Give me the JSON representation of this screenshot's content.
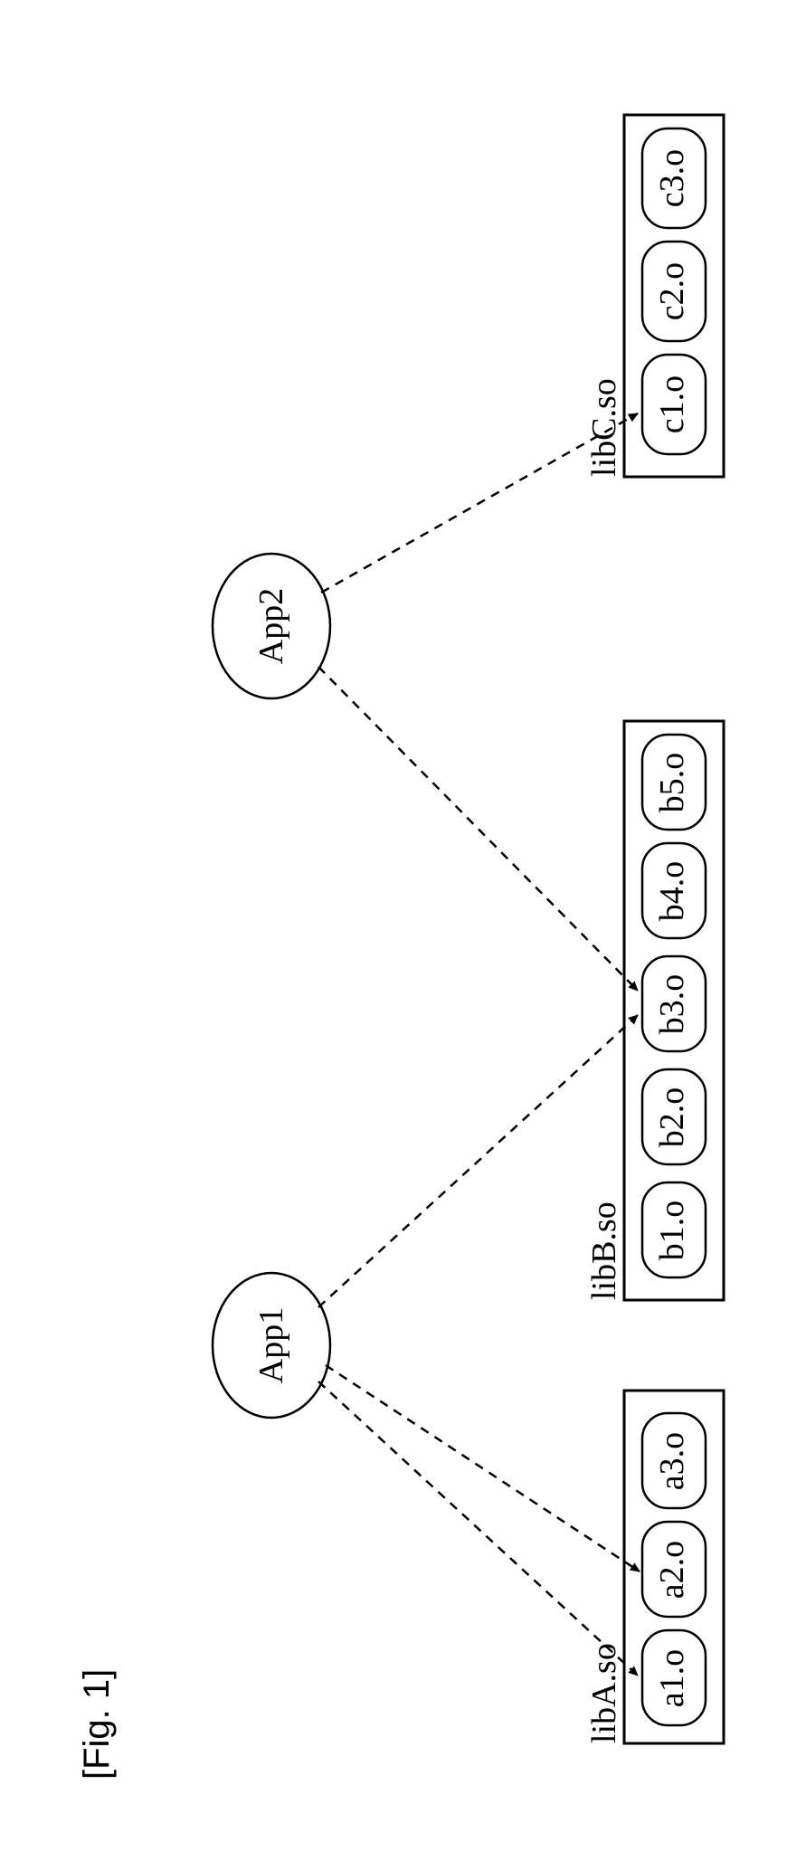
{
  "figure_label": "[Fig. 1]",
  "apps": {
    "app1": "App1",
    "app2": "App2"
  },
  "libraries": {
    "libA": {
      "name": "libA.so",
      "objects": [
        "a1.o",
        "a2.o",
        "a3.o"
      ]
    },
    "libB": {
      "name": "libB.so",
      "objects": [
        "b1.o",
        "b2.o",
        "b3.o",
        "b4.o",
        "b5.o"
      ]
    },
    "libC": {
      "name": "libC.so",
      "objects": [
        "c1.o",
        "c2.o",
        "c3.o"
      ]
    }
  },
  "chart_data": {
    "type": "table",
    "title": "Application to shared-library object dependencies",
    "nodes": {
      "applications": [
        "App1",
        "App2"
      ],
      "libraries": {
        "libA.so": [
          "a1.o",
          "a2.o",
          "a3.o"
        ],
        "libB.so": [
          "b1.o",
          "b2.o",
          "b3.o",
          "b4.o",
          "b5.o"
        ],
        "libC.so": [
          "c1.o",
          "c2.o",
          "c3.o"
        ]
      }
    },
    "edges": [
      {
        "from": "App1",
        "to": "libA.so:a1.o"
      },
      {
        "from": "App1",
        "to": "libA.so:a2.o"
      },
      {
        "from": "App1",
        "to": "libB.so:b3.o"
      },
      {
        "from": "App2",
        "to": "libB.so:b3.o"
      },
      {
        "from": "App2",
        "to": "libC.so:c1.o"
      }
    ]
  }
}
